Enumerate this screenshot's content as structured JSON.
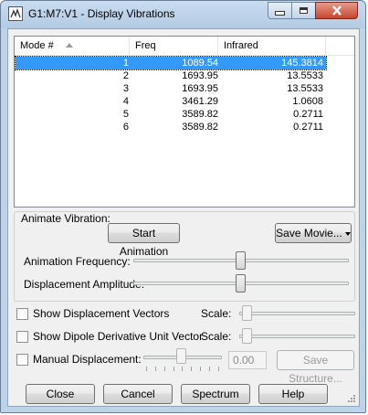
{
  "window": {
    "title": "G1:M7:V1 - Display Vibrations",
    "minimize_glyph": "minimize-icon",
    "maximize_glyph": "maximize-icon",
    "close_glyph": "close-icon"
  },
  "table": {
    "columns": [
      "Mode #",
      "Freq",
      "Infrared"
    ],
    "sort_indicator": "sort-ascending-icon",
    "rows": [
      {
        "mode": "1",
        "freq": "1089.54",
        "ir": "145.3814",
        "selected": true
      },
      {
        "mode": "2",
        "freq": "1693.95",
        "ir": "13.5533",
        "selected": false
      },
      {
        "mode": "3",
        "freq": "1693.95",
        "ir": "13.5533",
        "selected": false
      },
      {
        "mode": "4",
        "freq": "3461.29",
        "ir": "1.0608",
        "selected": false
      },
      {
        "mode": "5",
        "freq": "3589.82",
        "ir": "0.2711",
        "selected": false
      },
      {
        "mode": "6",
        "freq": "3589.82",
        "ir": "0.2711",
        "selected": false
      }
    ]
  },
  "animate": {
    "group_label": "Animate Vibration:",
    "start_button": "Start Animation",
    "save_movie_button": "Save Movie...",
    "frequency_label": "Animation Frequency:",
    "frequency_value": 0.5,
    "amplitude_label": "Displacement Amplitude:",
    "amplitude_value": 0.5
  },
  "options": {
    "show_vectors_label": "Show Displacement Vectors",
    "show_vectors_checked": false,
    "show_dipole_label": "Show Dipole Derivative Unit Vector",
    "show_dipole_checked": false,
    "scale_label": "Scale:",
    "manual_label": "Manual Displacement:",
    "manual_checked": false,
    "manual_value": "0.00",
    "save_structure_button": "Save Structure..."
  },
  "buttons": {
    "close": "Close",
    "cancel": "Cancel",
    "spectrum": "Spectrum",
    "help": "Help"
  },
  "colors": {
    "selection": "#3399ff",
    "frame": "#bcd3ea"
  }
}
